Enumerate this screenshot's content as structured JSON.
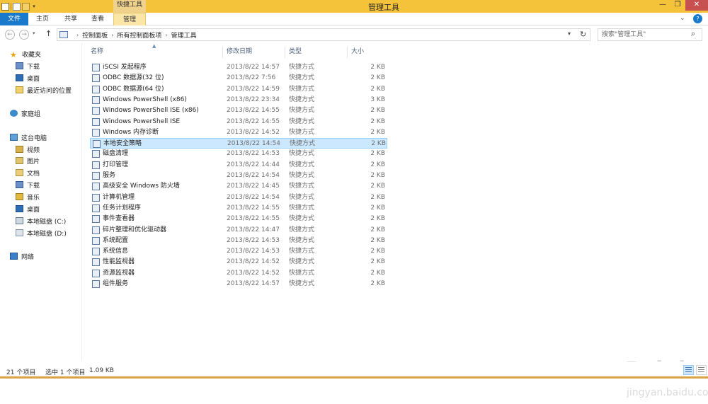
{
  "window": {
    "title": "管理工具",
    "context_tab_group": "快捷工具",
    "minimize": "—",
    "maximize": "❐",
    "close": "✕"
  },
  "ribbon": {
    "tabs": [
      {
        "label": "文件"
      },
      {
        "label": "主页"
      },
      {
        "label": "共享"
      },
      {
        "label": "查看"
      },
      {
        "label": "管理"
      }
    ],
    "expand_glyph": "⌄",
    "help_glyph": "?"
  },
  "address": {
    "breadcrumbs": [
      "控制面板",
      "所有控制面板项",
      "管理工具"
    ],
    "separator": "›",
    "search_placeholder": "搜索\"管理工具\""
  },
  "nav_pane": {
    "items": [
      {
        "label": "收藏夹",
        "icon": "star-icon"
      },
      {
        "label": "下载",
        "icon": "downloads-folder-icon"
      },
      {
        "label": "桌面",
        "icon": "desktop-folder-icon"
      },
      {
        "label": "最近访问的位置",
        "icon": "recent-places-icon"
      },
      {
        "label": "家庭组",
        "icon": "homegroup-icon"
      },
      {
        "label": "这台电脑",
        "icon": "this-pc-icon"
      },
      {
        "label": "视频",
        "icon": "videos-folder-icon"
      },
      {
        "label": "图片",
        "icon": "pictures-folder-icon"
      },
      {
        "label": "文档",
        "icon": "documents-folder-icon"
      },
      {
        "label": "下载",
        "icon": "downloads-folder-icon"
      },
      {
        "label": "音乐",
        "icon": "music-folder-icon"
      },
      {
        "label": "桌面",
        "icon": "desktop-folder-icon"
      },
      {
        "label": "本地磁盘 (C:)",
        "icon": "drive-c-icon"
      },
      {
        "label": "本地磁盘 (D:)",
        "icon": "drive-d-icon"
      },
      {
        "label": "网络",
        "icon": "network-icon"
      }
    ]
  },
  "file_list": {
    "columns": {
      "name": "名称",
      "date": "修改日期",
      "type": "类型",
      "size": "大小"
    },
    "rows": [
      {
        "name": "iSCSI 发起程序",
        "date": "2013/8/22 14:57",
        "type": "快捷方式",
        "size": "2 KB"
      },
      {
        "name": "ODBC 数据源(32 位)",
        "date": "2013/8/22 7:56",
        "type": "快捷方式",
        "size": "2 KB"
      },
      {
        "name": "ODBC 数据源(64 位)",
        "date": "2013/8/22 14:59",
        "type": "快捷方式",
        "size": "2 KB"
      },
      {
        "name": "Windows PowerShell (x86)",
        "date": "2013/8/22 23:34",
        "type": "快捷方式",
        "size": "3 KB"
      },
      {
        "name": "Windows PowerShell ISE (x86)",
        "date": "2013/8/22 14:55",
        "type": "快捷方式",
        "size": "2 KB"
      },
      {
        "name": "Windows PowerShell ISE",
        "date": "2013/8/22 14:55",
        "type": "快捷方式",
        "size": "2 KB"
      },
      {
        "name": "Windows 内存诊断",
        "date": "2013/8/22 14:52",
        "type": "快捷方式",
        "size": "2 KB"
      },
      {
        "name": "本地安全策略",
        "date": "2013/8/22 14:54",
        "type": "快捷方式",
        "size": "2 KB",
        "selected": true
      },
      {
        "name": "磁盘清理",
        "date": "2013/8/22 14:53",
        "type": "快捷方式",
        "size": "2 KB"
      },
      {
        "name": "打印管理",
        "date": "2013/8/22 14:44",
        "type": "快捷方式",
        "size": "2 KB"
      },
      {
        "name": "服务",
        "date": "2013/8/22 14:54",
        "type": "快捷方式",
        "size": "2 KB"
      },
      {
        "name": "高级安全 Windows 防火墙",
        "date": "2013/8/22 14:45",
        "type": "快捷方式",
        "size": "2 KB"
      },
      {
        "name": "计算机管理",
        "date": "2013/8/22 14:54",
        "type": "快捷方式",
        "size": "2 KB"
      },
      {
        "name": "任务计划程序",
        "date": "2013/8/22 14:55",
        "type": "快捷方式",
        "size": "2 KB"
      },
      {
        "name": "事件查看器",
        "date": "2013/8/22 14:55",
        "type": "快捷方式",
        "size": "2 KB"
      },
      {
        "name": "碎片整理和优化驱动器",
        "date": "2013/8/22 14:47",
        "type": "快捷方式",
        "size": "2 KB"
      },
      {
        "name": "系统配置",
        "date": "2013/8/22 14:53",
        "type": "快捷方式",
        "size": "2 KB"
      },
      {
        "name": "系统信息",
        "date": "2013/8/22 14:53",
        "type": "快捷方式",
        "size": "2 KB"
      },
      {
        "name": "性能监视器",
        "date": "2013/8/22 14:52",
        "type": "快捷方式",
        "size": "2 KB"
      },
      {
        "name": "资源监视器",
        "date": "2013/8/22 14:52",
        "type": "快捷方式",
        "size": "2 KB"
      },
      {
        "name": "组件服务",
        "date": "2013/8/22 14:57",
        "type": "快捷方式",
        "size": "2 KB"
      }
    ]
  },
  "status": {
    "item_count": "21 个项目",
    "selection": "选中 1 个项目",
    "selection_size": "1.09 KB"
  },
  "watermark": {
    "brand": "Bai du 经验",
    "url": "jingyan.baidu.com"
  },
  "colors": {
    "titlebar": "#f5c33a",
    "file_tab": "#1979ca",
    "selection": "#cce8ff"
  }
}
